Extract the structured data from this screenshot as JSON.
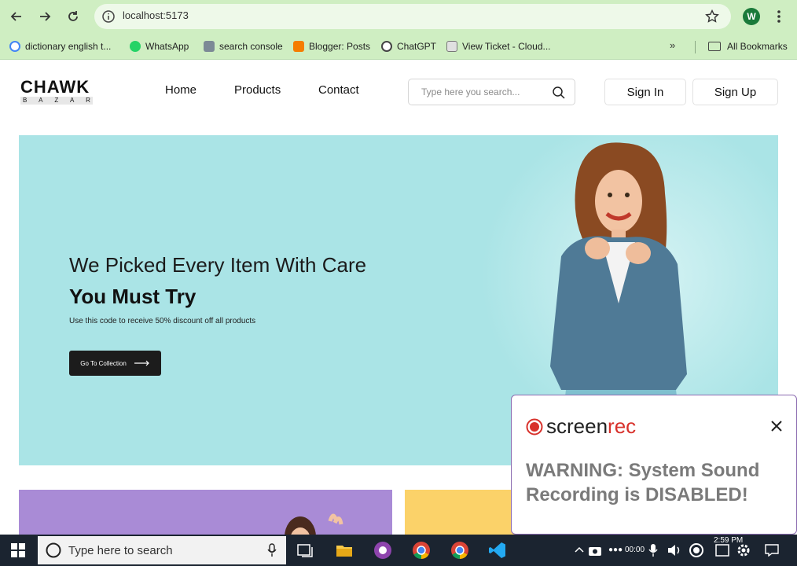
{
  "browser": {
    "url": "localhost:5173",
    "profile_initial": "W",
    "bookmarks": [
      {
        "label": "dictionary english t...",
        "icon": "google-icon",
        "color": "#4285f4"
      },
      {
        "label": "WhatsApp",
        "icon": "whatsapp-icon",
        "color": "#25d366"
      },
      {
        "label": "search console",
        "icon": "search-console-icon",
        "color": "#5f6368"
      },
      {
        "label": "Blogger: Posts",
        "icon": "blogger-icon",
        "color": "#f57d00"
      },
      {
        "label": "ChatGPT",
        "icon": "chatgpt-icon",
        "color": "#444444"
      },
      {
        "label": "View Ticket - Cloud...",
        "icon": "ticket-icon",
        "color": "#777777"
      }
    ],
    "more_label": "»",
    "all_bookmarks": "All Bookmarks"
  },
  "site": {
    "logo": {
      "main": "CHAWK",
      "sub": [
        "B",
        "A",
        "Z",
        "A",
        "R"
      ]
    },
    "nav": [
      "Home",
      "Products",
      "Contact"
    ],
    "search_placeholder": "Type here you search...",
    "sign_in": "Sign In",
    "sign_up": "Sign Up"
  },
  "hero": {
    "title": "We Picked Every Item With Care",
    "title_bold": "You Must Try",
    "subtitle": "Use this code to receive 50% discount off all products",
    "cta": "Go To Collection",
    "background": "#aae4e6"
  },
  "popup": {
    "brand_left": "screen",
    "brand_right": "rec",
    "warning": "WARNING: System Sound Recording is DISABLED!"
  },
  "taskbar": {
    "search_placeholder": "Type here to search",
    "clock": "2:59 PM",
    "rec_timer": "00:00"
  },
  "colors": {
    "chrome": "#cfeec2",
    "accent_red": "#d8312b",
    "purple_card": "#a98bd6",
    "yellow_card": "#fbd269"
  }
}
